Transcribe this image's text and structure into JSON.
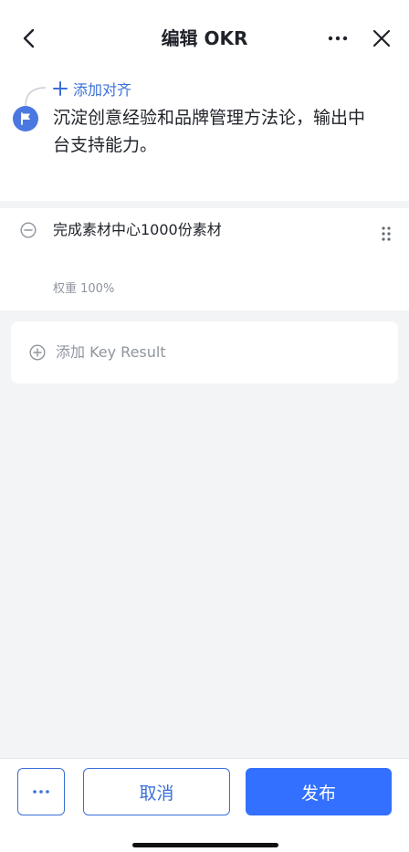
{
  "header": {
    "title": "编辑 OKR",
    "back_icon": "chevron-left-icon",
    "more_icon": "more-horizontal-icon",
    "close_icon": "close-icon"
  },
  "objective": {
    "align_label": "添加对齐",
    "text": "沉淀创意经验和品牌管理方法论，输出中台支持能力。",
    "icon": "flag-icon",
    "badge_color": "#4a78e0"
  },
  "key_results": [
    {
      "title": "完成素材中心1000份素材",
      "weight": "权重 100%"
    }
  ],
  "add_kr": {
    "label": "添加 Key Result"
  },
  "footer": {
    "more_label": "···",
    "cancel_label": "取消",
    "publish_label": "发布",
    "accent_color": "#3370ff"
  }
}
